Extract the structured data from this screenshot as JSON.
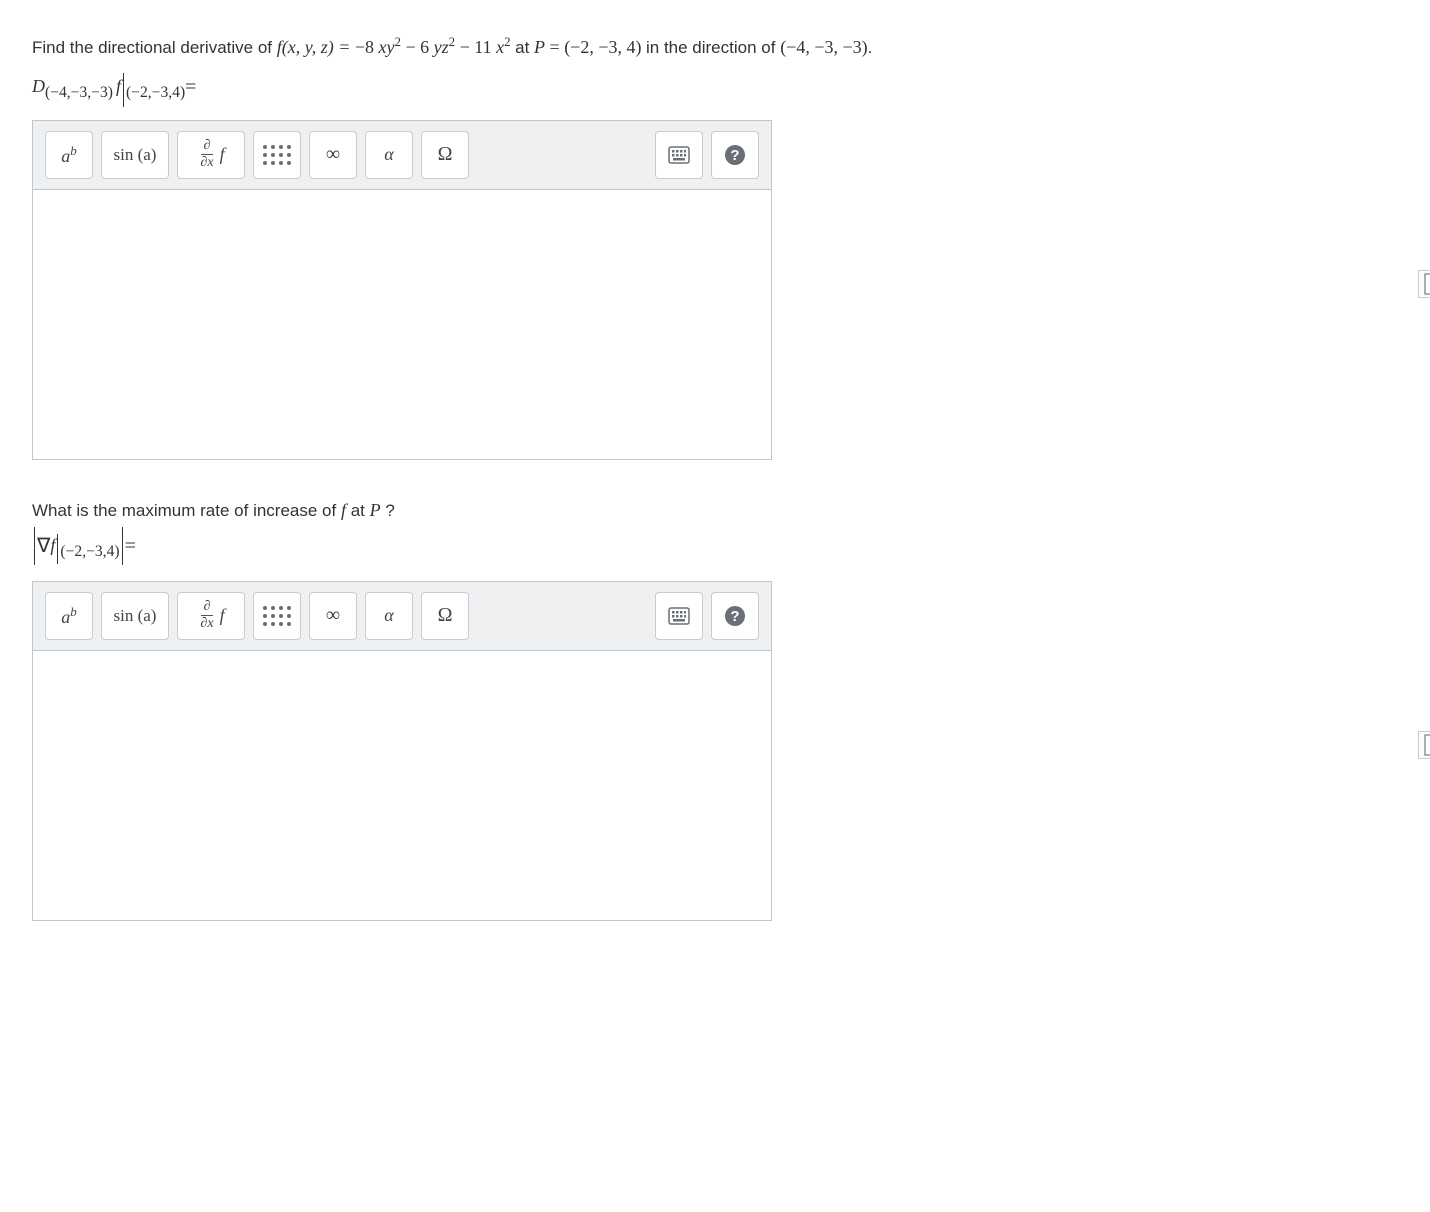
{
  "problem1": {
    "prefix": "Find the directional derivative of ",
    "funcLHS": "f(x, y, z) = ",
    "funcRHS_term1_coeff": "−8 ",
    "funcRHS_term1_base": "xy",
    "funcRHS_term1_exp": "2",
    "funcRHS_term2_prefix": " − 6 ",
    "funcRHS_term2_base": "yz",
    "funcRHS_term2_exp": "2",
    "funcRHS_term3_prefix": " − 11 ",
    "funcRHS_term3_base": "x",
    "funcRHS_term3_exp": "2",
    "atP_text": " at ",
    "P_var": "P",
    "P_eq": " = ",
    "P_value": "(−2, −3, 4)",
    "dir_text": " in the direction of ",
    "dir_value": "(−4, −3, −3)",
    "period": "."
  },
  "expr1": {
    "D": "D",
    "D_sub": "(−4,−3,−3)",
    "f": "f",
    "eval_sub": "(−2,−3,4)",
    "equals": " = "
  },
  "toolbar": {
    "ab_base": "a",
    "ab_exp": "b",
    "sin": "sin (a)",
    "partial_num": "∂",
    "partial_den": "∂x",
    "partial_f": " f",
    "infinity": "∞",
    "alpha": "α",
    "omega": "Ω"
  },
  "problem2": {
    "text_prefix": "What is the maximum rate of increase of ",
    "f": "f",
    "at": " at ",
    "P": "P",
    "question": " ?"
  },
  "expr2": {
    "nabla": "∇",
    "f": "f",
    "eval_sub": "(−2,−3,4)",
    "equals": " = "
  }
}
